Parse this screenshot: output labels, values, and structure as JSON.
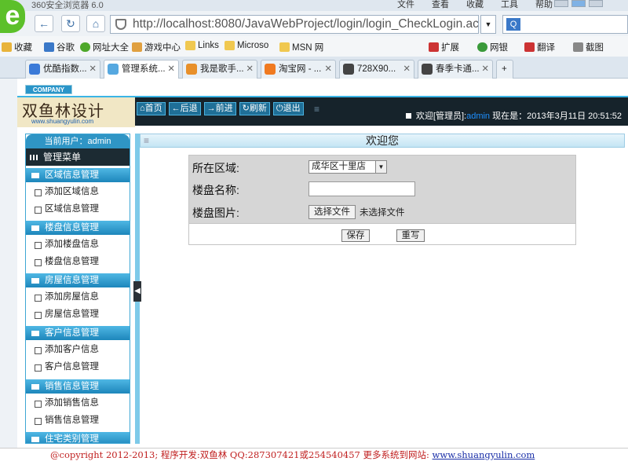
{
  "browser": {
    "brand": "360安全浏览器 6.0",
    "menu": [
      "文件",
      "查看",
      "收藏",
      "工具",
      "帮助"
    ],
    "url": "http://localhost:8080/JavaWebProject/login/login_CheckLogin.ac",
    "bookmarks": [
      "收藏",
      "谷歌",
      "网址大全",
      "游戏中心",
      "Links",
      "Microso",
      "MSN 网"
    ],
    "toolbar_right": [
      "扩展",
      "网银",
      "翻译",
      "截图"
    ],
    "tabs": [
      "优酷指数...",
      "管理系统...",
      "我是歌手...",
      "淘宝网 - ...",
      "728X90...",
      "春季卡通..."
    ]
  },
  "header": {
    "company": "COMPANY",
    "logo_main": "双鱼林设计",
    "logo_sub": "www.shuangyulin.com",
    "nav": [
      "首页",
      "后退",
      "前进",
      "刷新",
      "退出"
    ],
    "welcome_prefix": "欢迎[管理员]:",
    "admin": "admin",
    "time_prefix": "现在是：",
    "time": "2013年3月11日 20:51:52"
  },
  "sidebar": {
    "current_user": "当前用户：admin",
    "menu_title": "管理菜单",
    "sections": [
      {
        "title": "区域信息管理",
        "items": [
          "添加区域信息",
          "区域信息管理"
        ]
      },
      {
        "title": "楼盘信息管理",
        "items": [
          "添加楼盘信息",
          "楼盘信息管理"
        ]
      },
      {
        "title": "房屋信息管理",
        "items": [
          "添加房屋信息",
          "房屋信息管理"
        ]
      },
      {
        "title": "客户信息管理",
        "items": [
          "添加客户信息",
          "客户信息管理"
        ]
      },
      {
        "title": "销售信息管理",
        "items": [
          "添加销售信息",
          "销售信息管理"
        ]
      },
      {
        "title": "住宅类别管理",
        "items": []
      }
    ]
  },
  "content": {
    "title": "欢迎您",
    "form": {
      "area_label": "所在区域:",
      "area_value": "成华区十里店",
      "name_label": "楼盘名称:",
      "name_value": "",
      "image_label": "楼盘图片:",
      "file_button": "选择文件",
      "file_status": "未选择文件",
      "save": "保存",
      "reset": "重写"
    }
  },
  "footer": {
    "text": "@copyright 2012-2013; 程序开发:双鱼林  QQ:287307421或254540457  更多系统到网站:",
    "link": "www.shuangyulin.com"
  }
}
